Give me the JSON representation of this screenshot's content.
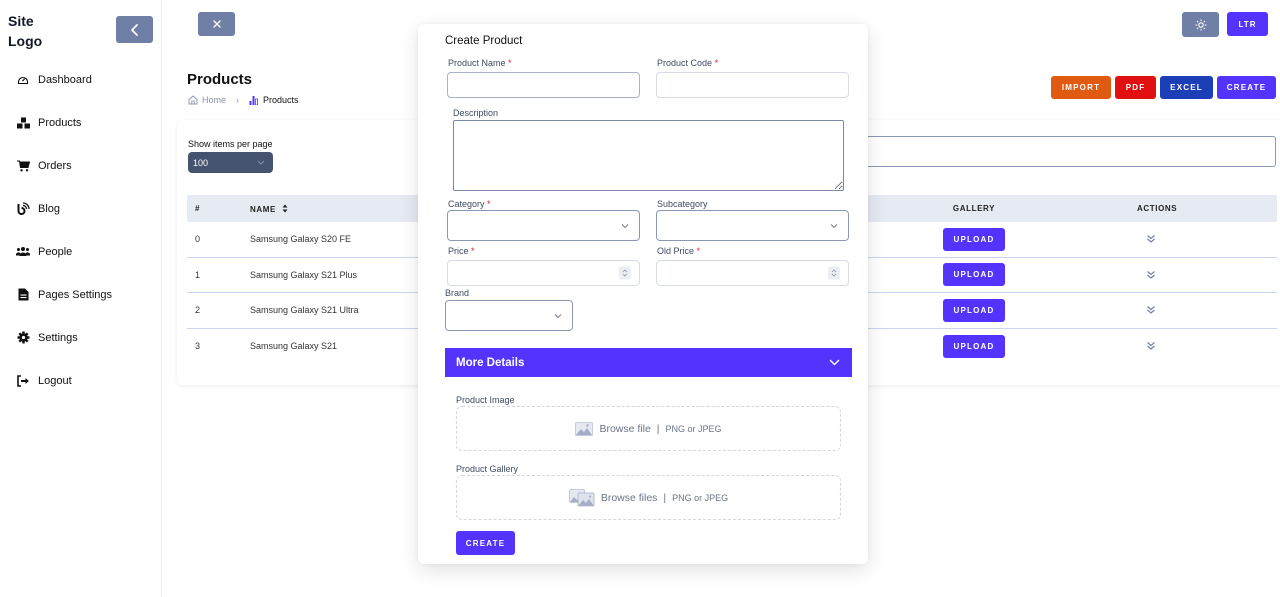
{
  "sidebar": {
    "logo": "Site Logo",
    "collapse_icon": "chevron-left-icon",
    "items": [
      {
        "label": "Dashboard",
        "icon": "dashboard-gauge-icon"
      },
      {
        "label": "Products",
        "icon": "boxes-icon"
      },
      {
        "label": "Orders",
        "icon": "cart-icon"
      },
      {
        "label": "Blog",
        "icon": "blog-icon"
      },
      {
        "label": "People",
        "icon": "people-icon"
      },
      {
        "label": "Pages Settings",
        "icon": "file-icon"
      },
      {
        "label": "Settings",
        "icon": "gear-icon"
      },
      {
        "label": "Logout",
        "icon": "logout-icon"
      }
    ]
  },
  "topbar": {
    "close_icon": "close-icon",
    "theme_icon": "sun-icon",
    "direction_label": "LTR"
  },
  "header": {
    "title": "Products",
    "breadcrumb": {
      "home": "Home",
      "current": "Products"
    },
    "actions": [
      {
        "label": "IMPORT",
        "color": "#e05a12"
      },
      {
        "label": "PDF",
        "color": "#e01010"
      },
      {
        "label": "EXCEL",
        "color": "#1c3fb8"
      },
      {
        "label": "CREATE",
        "color": "#5533ff"
      }
    ]
  },
  "list": {
    "per_page_label": "Show items per page",
    "per_page_value": "100",
    "search_value": "",
    "columns": {
      "id": "#",
      "name": "NAME",
      "gallery": "GALLERY",
      "actions": "ACTIONS"
    },
    "rows": [
      {
        "id": "0",
        "name": "Samsung Galaxy S20 FE",
        "upload": "UPLOAD"
      },
      {
        "id": "1",
        "name": "Samsung Galaxy S21 Plus",
        "upload": "UPLOAD"
      },
      {
        "id": "2",
        "name": "Samsung Galaxy S21 Ultra",
        "upload": "UPLOAD"
      },
      {
        "id": "3",
        "name": "Samsung Galaxy S21",
        "upload": "UPLOAD"
      }
    ]
  },
  "modal": {
    "title": "Create Product",
    "fields": {
      "product_name": {
        "label": "Product Name",
        "required": "*",
        "value": ""
      },
      "product_code": {
        "label": "Product Code",
        "required": "*",
        "value": ""
      },
      "description": {
        "label": "Description",
        "value": ""
      },
      "category": {
        "label": "Category",
        "required": "*",
        "value": ""
      },
      "subcategory": {
        "label": "Subcategory",
        "value": ""
      },
      "price": {
        "label": "Price",
        "required": "*",
        "value": ""
      },
      "old_price": {
        "label": "Old Price",
        "required": "*",
        "value": ""
      },
      "brand": {
        "label": "Brand",
        "value": ""
      }
    },
    "more_details": "More Details",
    "product_image": {
      "label": "Product Image",
      "browse": "Browse file",
      "sep": "|",
      "hint": "PNG or JPEG"
    },
    "product_gallery": {
      "label": "Product Gallery",
      "browse": "Browse files",
      "sep": "|",
      "hint": "PNG or JPEG"
    },
    "submit": "CREATE"
  },
  "colors": {
    "primary": "#5533ff",
    "slate_button": "#6f7fa6",
    "select_bg": "#45536e"
  }
}
